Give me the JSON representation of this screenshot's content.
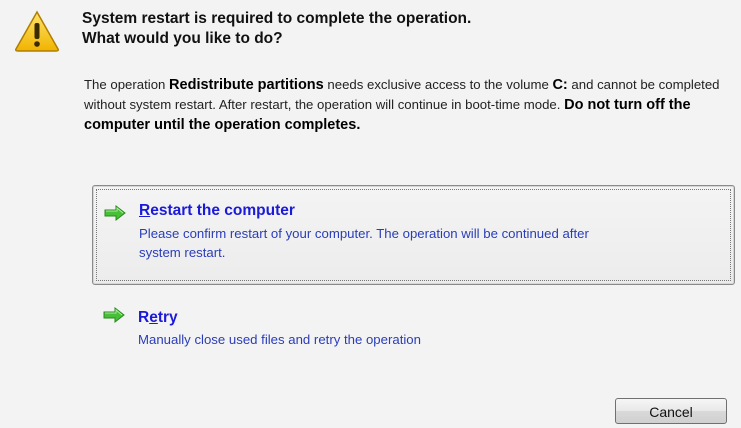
{
  "dialog": {
    "header": {
      "line1": "System restart is required to complete the operation.",
      "line2": "What would you like to do?"
    },
    "description": {
      "part1": "The operation ",
      "operation_name": "Redistribute partitions",
      "part2": " needs exclusive access to the volume ",
      "volume": "C:",
      "part3": " and cannot be completed without system restart. After restart, the operation will continue in boot-time mode. ",
      "warning": "Do not turn off the computer until the operation completes",
      "end": "."
    },
    "options": [
      {
        "title_accel": "R",
        "title_rest": "estart the computer",
        "description_line1": "Please confirm restart of your computer. The operation will be continued after",
        "description_line2": "system restart.",
        "icon": "green-arrow-right-icon"
      },
      {
        "title_pre": "R",
        "title_accel": "e",
        "title_rest": "try",
        "description": "Manually close used files and retry the operation",
        "icon": "green-arrow-right-icon"
      }
    ],
    "cancel_label": "Cancel",
    "colors": {
      "link_blue": "#1a1ad8",
      "description_blue": "#2a3db8",
      "arrow_green": "#3fb82f",
      "warning_yellow": "#f5c400"
    }
  }
}
